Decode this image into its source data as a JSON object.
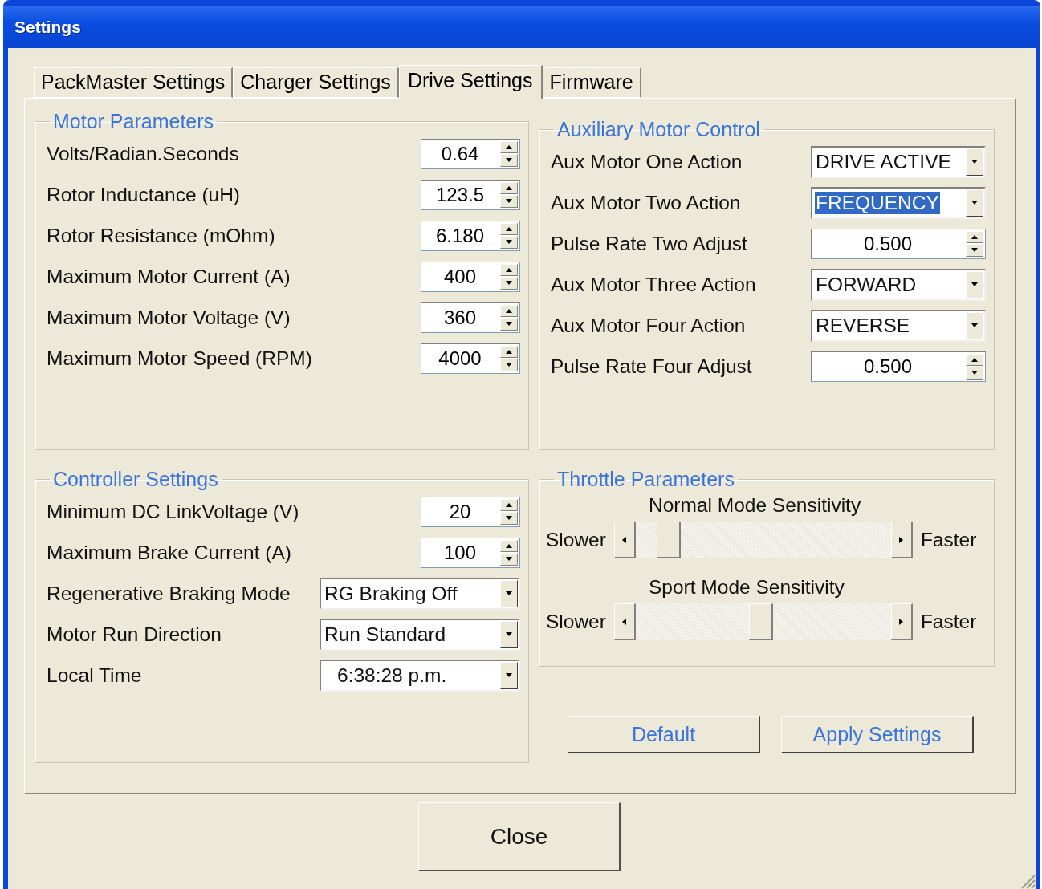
{
  "window": {
    "title": "Settings"
  },
  "tabs": [
    {
      "label": "PackMaster Settings",
      "selected": false
    },
    {
      "label": "Charger Settings",
      "selected": false
    },
    {
      "label": "Drive Settings",
      "selected": true
    },
    {
      "label": "Firmware",
      "selected": false
    }
  ],
  "motor_parameters": {
    "title": "Motor Parameters",
    "fields": [
      {
        "label": "Volts/Radian.Seconds",
        "kind": "spin",
        "value": "0.64"
      },
      {
        "label": "Rotor Inductance (uH)",
        "kind": "spin",
        "value": "123.5"
      },
      {
        "label": "Rotor Resistance (mOhm)",
        "kind": "spin",
        "value": "6.180"
      },
      {
        "label": "Maximum Motor Current (A)",
        "kind": "spin",
        "value": "400"
      },
      {
        "label": "Maximum Motor Voltage (V)",
        "kind": "spin",
        "value": "360"
      },
      {
        "label": "Maximum Motor Speed (RPM)",
        "kind": "spin",
        "value": "4000"
      }
    ]
  },
  "auxiliary_motor_control": {
    "title": "Auxiliary Motor Control",
    "fields": [
      {
        "label": "Aux Motor One Action",
        "kind": "combo",
        "value": "DRIVE ACTIVE",
        "highlighted": false
      },
      {
        "label": "Aux Motor Two Action",
        "kind": "combo",
        "value": "FREQUENCY",
        "highlighted": true
      },
      {
        "label": "Pulse Rate Two Adjust",
        "kind": "spin",
        "value": "0.500"
      },
      {
        "label": "Aux Motor Three Action",
        "kind": "combo",
        "value": "FORWARD",
        "highlighted": false
      },
      {
        "label": "Aux Motor Four Action",
        "kind": "combo",
        "value": "REVERSE",
        "highlighted": false
      },
      {
        "label": "Pulse Rate Four Adjust",
        "kind": "spin",
        "value": "0.500"
      }
    ]
  },
  "controller_settings": {
    "title": "Controller Settings",
    "fields": [
      {
        "label": "Minimum DC LinkVoltage (V)",
        "kind": "spin",
        "value": "20"
      },
      {
        "label": "Maximum Brake Current (A)",
        "kind": "spin",
        "value": "100"
      },
      {
        "label": "Regenerative Braking Mode",
        "kind": "combo",
        "value": "RG Braking Off",
        "highlighted": false
      },
      {
        "label": "Motor Run Direction",
        "kind": "combo",
        "value": "Run Standard",
        "highlighted": false
      },
      {
        "label": "Local Time",
        "kind": "combo",
        "value": "6:38:28 p.m.",
        "highlighted": false
      }
    ]
  },
  "throttle_parameters": {
    "title": "Throttle Parameters",
    "sliders": [
      {
        "label": "Normal Mode Sensitivity",
        "left": "Slower",
        "right": "Faster",
        "level": 0.09
      },
      {
        "label": "Sport Mode Sensitivity",
        "left": "Slower",
        "right": "Faster",
        "level": 0.49
      }
    ]
  },
  "buttons": [
    "Default",
    "Apply Settings"
  ],
  "close_button": "Close"
}
